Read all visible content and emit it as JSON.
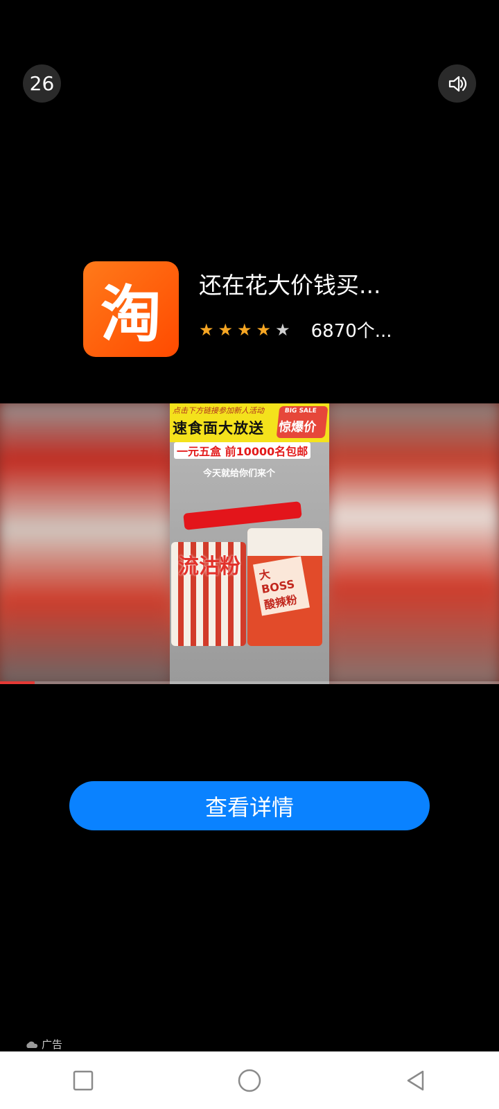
{
  "countdown": "26",
  "sound_icon": "speaker-icon",
  "app": {
    "icon_glyph": "淘",
    "title": "还在花大价钱买...",
    "rating": 4,
    "rating_max": 5,
    "reviews": "6870个..."
  },
  "media": {
    "banner_line1": "点击下方链接参加新人活动",
    "banner_line2": "速食面大放送",
    "banner_tag_small": "BIG SALE",
    "banner_tag_big": "惊爆价",
    "offer": "一元五盒 前10000名包邮",
    "caption": "今天就给你们来个",
    "cup1_label": "流沽粉",
    "cup2_label": "大BOSS 酸辣粉",
    "progress": 0.07
  },
  "cta_label": "查看详情",
  "ad_label": "广告",
  "colors": {
    "cta": "#0a82ff",
    "star_on": "#f6a623",
    "star_off": "#cfcfcf",
    "brand": "#ff5a00"
  },
  "navbar": {
    "recent_icon": "square-icon",
    "home_icon": "circle-icon",
    "back_icon": "triangle-back-icon"
  }
}
